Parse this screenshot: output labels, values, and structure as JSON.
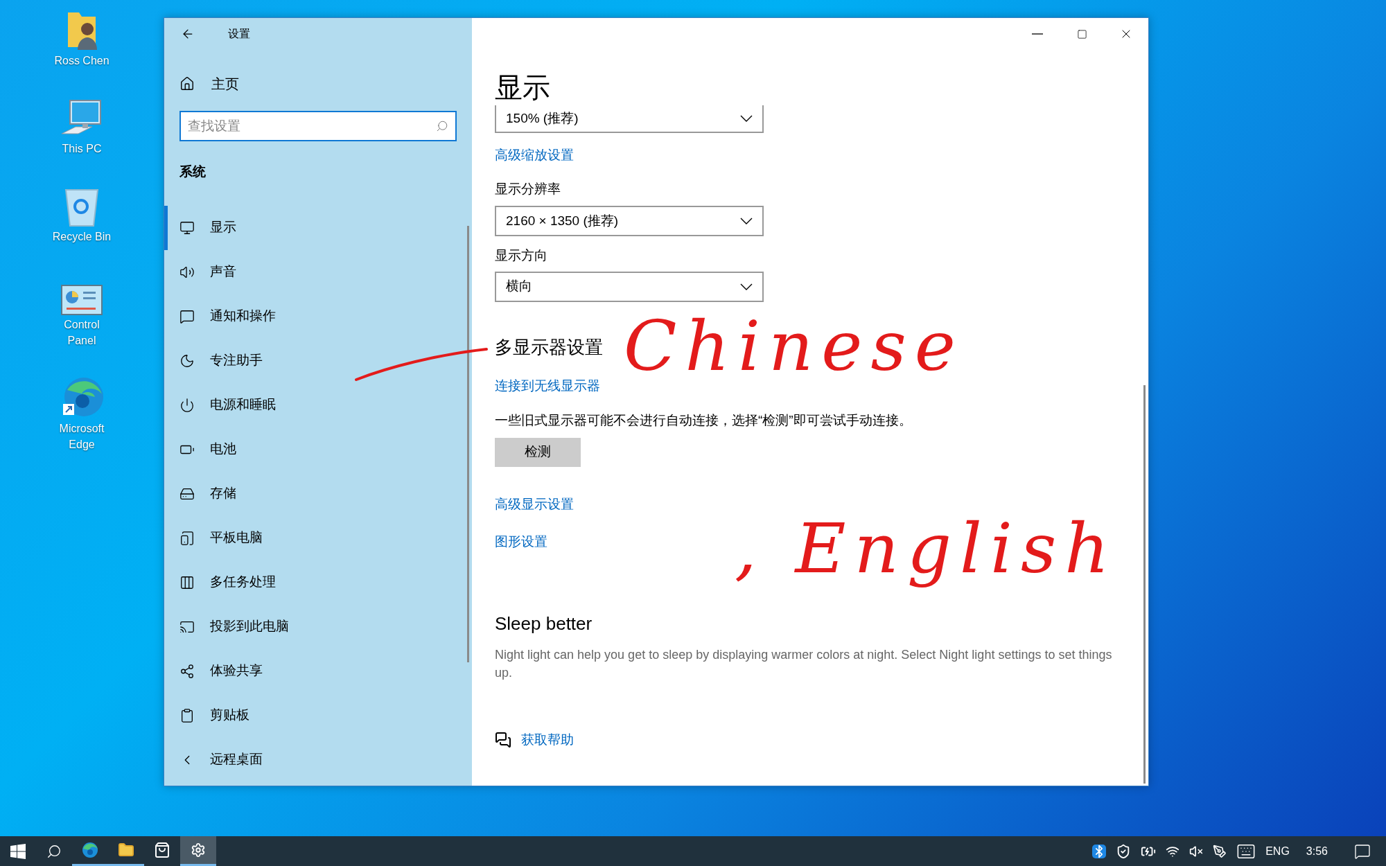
{
  "desktop_icons": [
    {
      "label": "Ross Chen"
    },
    {
      "label": "This PC"
    },
    {
      "label": "Recycle Bin"
    },
    {
      "label": "Control Panel"
    },
    {
      "label": "Microsoft Edge"
    }
  ],
  "window": {
    "title": "设置",
    "home": "主页",
    "search": {
      "placeholder": "查找设置"
    },
    "section": "系统",
    "sidebar": {
      "items": [
        {
          "label": "显示",
          "selected": true
        },
        {
          "label": "声音",
          "selected": false
        },
        {
          "label": "通知和操作",
          "selected": false
        },
        {
          "label": "专注助手",
          "selected": false
        },
        {
          "label": "电源和睡眠",
          "selected": false
        },
        {
          "label": "电池",
          "selected": false
        },
        {
          "label": "存储",
          "selected": false
        },
        {
          "label": "平板电脑",
          "selected": false
        },
        {
          "label": "多任务处理",
          "selected": false
        },
        {
          "label": "投影到此电脑",
          "selected": false
        },
        {
          "label": "体验共享",
          "selected": false
        },
        {
          "label": "剪贴板",
          "selected": false
        },
        {
          "label": "远程桌面",
          "selected": false
        }
      ]
    }
  },
  "page": {
    "title": "显示",
    "scale_dropdown": {
      "value": "150% (推荐)"
    },
    "scale_link": "高级缩放设置",
    "resolution": {
      "label": "显示分辨率",
      "value": "2160 × 1350 (推荐)"
    },
    "orientation": {
      "label": "显示方向",
      "value": "横向"
    },
    "multi_display": {
      "heading": "多显示器设置",
      "link": "连接到无线显示器",
      "note": "一些旧式显示器可能不会进行自动连接，选择“检测”即可尝试手动连接。",
      "button": "检测"
    },
    "links": [
      "高级显示设置",
      "图形设置"
    ],
    "sleep": {
      "heading": "Sleep better",
      "text": "Night light can help you get to sleep by displaying warmer colors at night. Select Night light settings to set things up."
    },
    "help": "获取帮助"
  },
  "ink_annotations": [
    "Chinese",
    ", English"
  ],
  "taskbar": {
    "apps": [
      {
        "selected": false,
        "running": true
      },
      {
        "selected": false,
        "running": true
      },
      {
        "selected": false,
        "running": false
      },
      {
        "selected": true,
        "running": true
      }
    ],
    "language": "ENG",
    "time": "3:56"
  }
}
